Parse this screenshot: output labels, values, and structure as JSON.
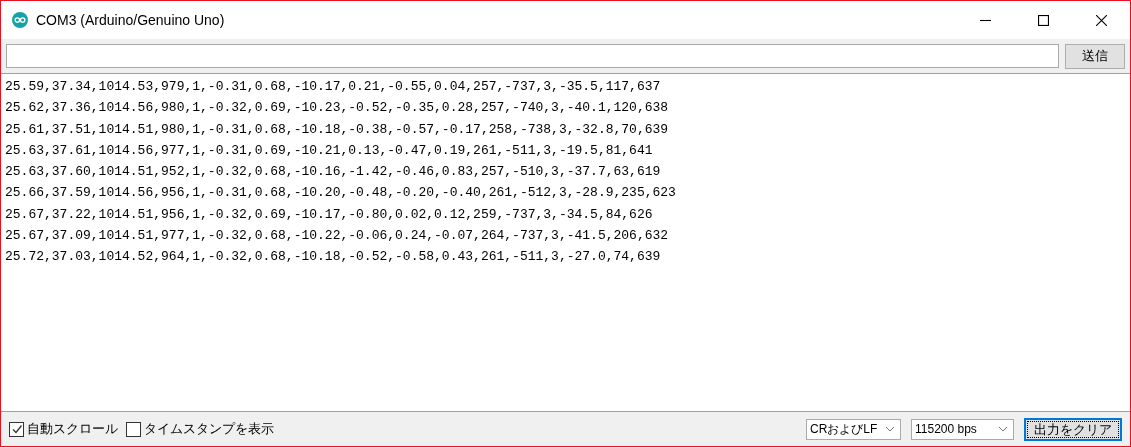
{
  "window": {
    "title": "COM3 (Arduino/Genuino Uno)"
  },
  "send_bar": {
    "button": "送信"
  },
  "output_lines": [
    "25.59,37.34,1014.53,979,1,-0.31,0.68,-10.17,0.21,-0.55,0.04,257,-737,3,-35.5,117,637",
    "25.62,37.36,1014.56,980,1,-0.32,0.69,-10.23,-0.52,-0.35,0.28,257,-740,3,-40.1,120,638",
    "25.61,37.51,1014.51,980,1,-0.31,0.68,-10.18,-0.38,-0.57,-0.17,258,-738,3,-32.8,70,639",
    "25.63,37.61,1014.56,977,1,-0.31,0.69,-10.21,0.13,-0.47,0.19,261,-511,3,-19.5,81,641",
    "25.63,37.60,1014.51,952,1,-0.32,0.68,-10.16,-1.42,-0.46,0.83,257,-510,3,-37.7,63,619",
    "25.66,37.59,1014.56,956,1,-0.31,0.68,-10.20,-0.48,-0.20,-0.40,261,-512,3,-28.9,235,623",
    "25.67,37.22,1014.51,956,1,-0.32,0.69,-10.17,-0.80,0.02,0.12,259,-737,3,-34.5,84,626",
    "25.67,37.09,1014.51,977,1,-0.32,0.68,-10.22,-0.06,0.24,-0.07,264,-737,3,-41.5,206,632",
    "25.72,37.03,1014.52,964,1,-0.32,0.68,-10.18,-0.52,-0.58,0.43,261,-511,3,-27.0,74,639"
  ],
  "status_bar": {
    "checkboxes": [
      {
        "label": "自動スクロール",
        "checked": true
      },
      {
        "label": "タイムスタンプを表示",
        "checked": false
      }
    ],
    "line_ending": "CRおよびLF",
    "baud_rate": "115200 bps",
    "clear_button": "出力をクリア"
  }
}
